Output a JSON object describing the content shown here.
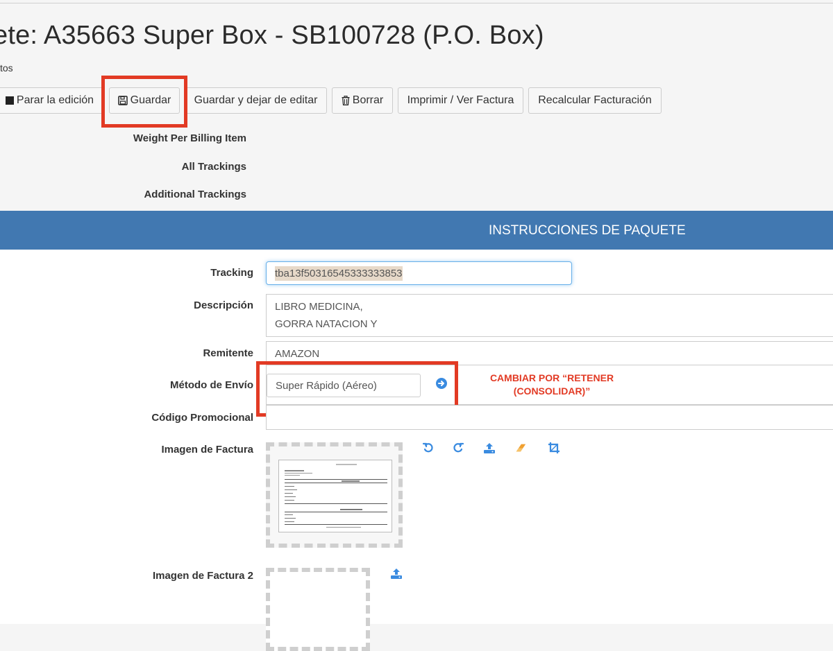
{
  "header": {
    "title": "ete: A35663 Super Box - SB100728 (P.O. Box)",
    "breadcrumb": "tos"
  },
  "toolbar": {
    "stop_edit": "Parar la edición",
    "save": "Guardar",
    "save_and_stop": "Guardar y dejar de editar",
    "delete": "Borrar",
    "print": "Imprimir / Ver Factura",
    "recalculate": "Recalcular Facturación"
  },
  "info_labels": {
    "weight": "Weight Per Billing Item",
    "all_trackings": "All Trackings",
    "additional_trackings": "Additional Trackings"
  },
  "section": {
    "title": "INSTRUCCIONES DE PAQUETE"
  },
  "form": {
    "tracking_label": "Tracking",
    "tracking_value": "tba13f50316545333333853",
    "description_label": "Descripción",
    "description_line1": "LIBRO MEDICINA,",
    "description_line2": "GORRA NATACION Y",
    "sender_label": "Remitente",
    "sender_value": "AMAZON",
    "shipping_label": "Método de Envío",
    "shipping_value": "Super Rápido (Aéreo)",
    "promo_label": "Código Promocional",
    "invoice_label": "Imagen de Factura",
    "invoice2_label": "Imagen de Factura 2"
  },
  "annotation": {
    "line1": "CAMBIAR POR “RETENER",
    "line2": "(CONSOLIDAR)”"
  },
  "colors": {
    "banner": "#4178b1",
    "annotation_red": "#e23a24",
    "icon_blue": "#3a8be0",
    "eraser_orange": "#f0a030"
  }
}
